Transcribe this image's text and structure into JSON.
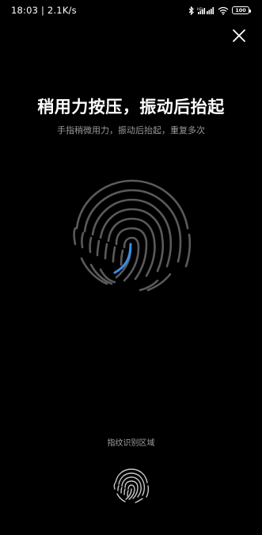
{
  "status_bar": {
    "time_speed": "18:03 | 2.1K/s",
    "battery_level": "100",
    "icons": [
      "bluetooth-icon",
      "signal-icon",
      "wifi-icon",
      "battery-icon"
    ]
  },
  "close": {
    "icon": "close-icon"
  },
  "title": "稍用力按压，振动后抬起",
  "subtitle": "手指稍微用力，振动后抬起，重复多次",
  "enroll_progress_color": "#3a8fe8",
  "sensor_label": "指纹识别区域",
  "colors": {
    "background": "#000000",
    "fingerprint_lines": "#5a5a5a",
    "sensor_lines": "#c8c8c8",
    "progress_accent": "#3a8fe8"
  }
}
